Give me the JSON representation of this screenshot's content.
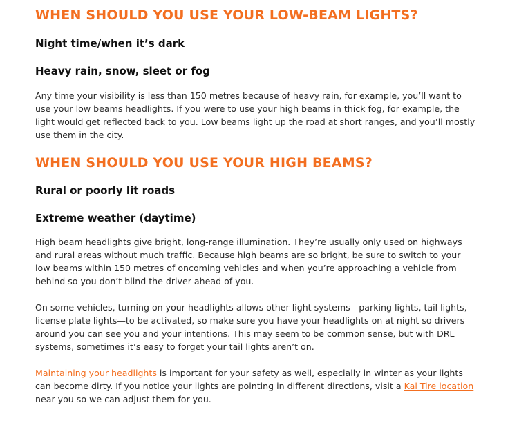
{
  "colors": {
    "accent": "#f36f21",
    "heading_text": "#111111",
    "body_text": "#2a2a2a",
    "background": "#ffffff"
  },
  "section1": {
    "heading": "WHEN SHOULD YOU USE YOUR LOW-BEAM LIGHTS?",
    "subheading1": "Night time/when it’s dark",
    "subheading2": "Heavy rain, snow, sleet or fog",
    "paragraph": "Any time your visibility is less than 150 metres because of heavy rain, for example, you’ll want to use your low beams headlights. If you were to use your high beams in thick fog, for example, the light would get reflected back to you. Low beams light up the road at short ranges, and you’ll mostly use them in the city."
  },
  "section2": {
    "heading": "WHEN SHOULD YOU USE YOUR HIGH BEAMS?",
    "subheading1": "Rural or poorly lit roads",
    "subheading2": "Extreme weather (daytime)",
    "paragraph1": "High beam headlights give bright, long-range illumination. They’re usually only used on highways and rural areas without much traffic. Because high beams are so bright, be sure to switch to your low beams within 150 metres of oncoming vehicles and when you’re approaching a vehicle from behind so you don’t blind the driver ahead of you.",
    "paragraph2": "On some vehicles, turning on your headlights allows other light systems—parking lights, tail lights, license plate lights—to be activated, so make sure you have your headlights on at night so drivers around you can see you and your intentions. This may seem to be common sense, but with DRL systems, sometimes it’s easy to forget your tail lights aren’t on.",
    "paragraph3": {
      "link1_text": "Maintaining your headlights",
      "text1": " is important for your safety as well, especially in winter as your lights can become dirty. If you notice your lights are pointing in different directions, visit a ",
      "link2_text": "Kal Tire location",
      "text2": " near you so we can adjust them for you."
    }
  }
}
